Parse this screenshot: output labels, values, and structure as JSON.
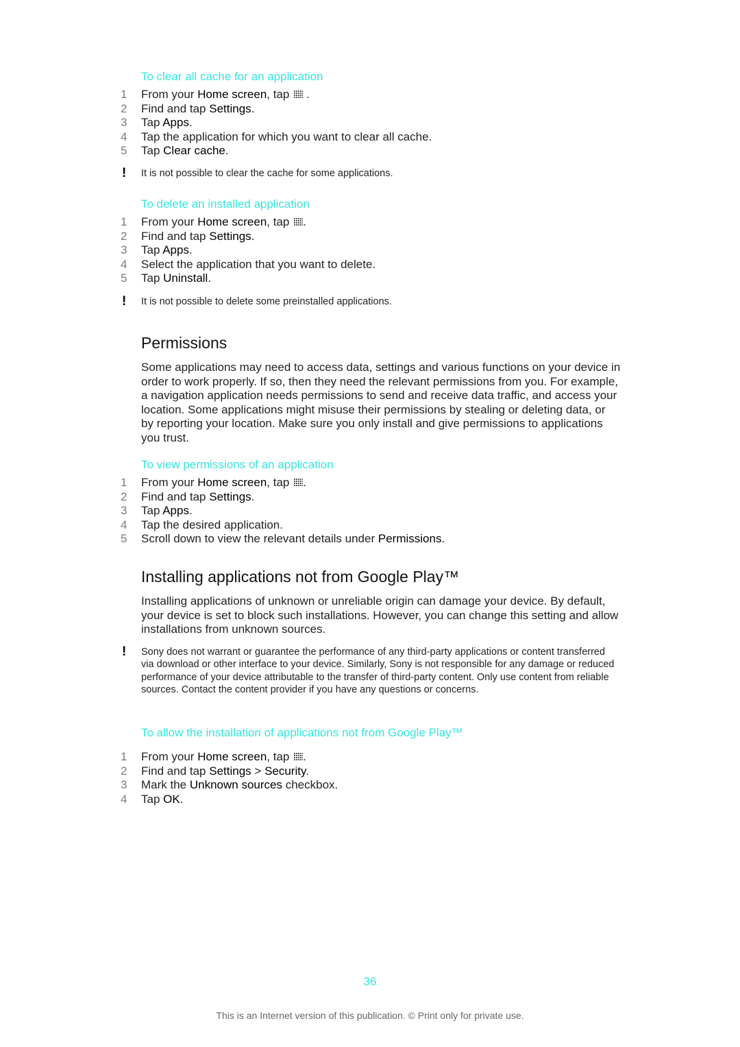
{
  "sections": {
    "clear_cache": {
      "heading": "To clear all cache for an application",
      "steps": [
        {
          "num": "1",
          "pre": "From your ",
          "bold": "Home screen",
          "post": ", tap",
          "icon": "apps-grid-icon",
          "end": " ."
        },
        {
          "num": "2",
          "pre": "Find and tap ",
          "bold": "Settings",
          "post": "."
        },
        {
          "num": "3",
          "pre": "Tap ",
          "bold": "Apps",
          "post": "."
        },
        {
          "num": "4",
          "pre": "Tap the application for which you want to clear all cache.",
          "bold": "",
          "post": ""
        },
        {
          "num": "5",
          "pre": "Tap ",
          "bold": "Clear cache",
          "post": "."
        }
      ],
      "note": "It is not possible to clear the cache for some applications."
    },
    "delete_app": {
      "heading": "To delete an installed application",
      "steps": [
        {
          "num": "1",
          "pre": "From your ",
          "bold": "Home screen",
          "post": ", tap",
          "icon": "apps-grid-icon",
          "end": "."
        },
        {
          "num": "2",
          "pre": "Find and tap ",
          "bold": "Settings",
          "post": "."
        },
        {
          "num": "3",
          "pre": "Tap ",
          "bold": "Apps",
          "post": "."
        },
        {
          "num": "4",
          "pre": "Select the application that you want to delete.",
          "bold": "",
          "post": ""
        },
        {
          "num": "5",
          "pre": "Tap ",
          "bold": "Uninstall",
          "post": "."
        }
      ],
      "note": "It is not possible to delete some preinstalled applications."
    },
    "permissions": {
      "title": "Permissions",
      "body": "Some applications may need to access data, settings and various functions on your device in order to work properly. If so, then they need the relevant permissions from you. For example, a navigation application needs permissions to send and receive data traffic, and access your location. Some applications might misuse their permissions by stealing or deleting data, or by reporting your location. Make sure you only install and give permissions to applications you trust."
    },
    "view_permissions": {
      "heading": "To view permissions of an application",
      "steps": [
        {
          "num": "1",
          "pre": "From your ",
          "bold": "Home screen",
          "post": ", tap",
          "icon": "apps-grid-icon",
          "end": "."
        },
        {
          "num": "2",
          "pre": "Find and tap ",
          "bold": "Settings",
          "post": "."
        },
        {
          "num": "3",
          "pre": "Tap ",
          "bold": "Apps",
          "post": "."
        },
        {
          "num": "4",
          "pre": "Tap the desired application.",
          "bold": "",
          "post": ""
        },
        {
          "num": "5",
          "pre": "Scroll down to view the relevant details under ",
          "bold": "Permissions",
          "post": "."
        }
      ]
    },
    "unknown_sources": {
      "title": "Installing applications not from Google Play™",
      "body": "Installing applications of unknown or unreliable origin can damage your device. By default, your device is set to block such installations. However, you can change this setting and allow installations from unknown sources.",
      "note": "Sony does not warrant or guarantee the performance of any third-party applications or content transferred via download or other interface to your device. Similarly, Sony is not responsible for any damage or reduced performance of your device attributable to the transfer of third-party content. Only use content from reliable sources. Contact the content provider if you have any questions or concerns."
    },
    "allow_install": {
      "heading": "To allow the installation of applications not from Google Play™",
      "steps": [
        {
          "num": "1",
          "pre": "From your ",
          "bold": "Home screen",
          "post": ", tap",
          "icon": "apps-grid-icon",
          "end": "."
        },
        {
          "num": "2",
          "pre": "Find and tap ",
          "bold": "Settings",
          "post": " > ",
          "bold2": "Security",
          "post2": "."
        },
        {
          "num": "3",
          "pre": "Mark the ",
          "bold": "Unknown sources",
          "post": " checkbox."
        },
        {
          "num": "4",
          "pre": "Tap ",
          "bold": "OK",
          "post": "."
        }
      ]
    }
  },
  "page_number": "36",
  "footer": "This is an Internet version of this publication. © Print only for private use.",
  "colors": {
    "accent": "#33e6dd",
    "text": "#222222",
    "step_number": "#7a7a7a"
  }
}
